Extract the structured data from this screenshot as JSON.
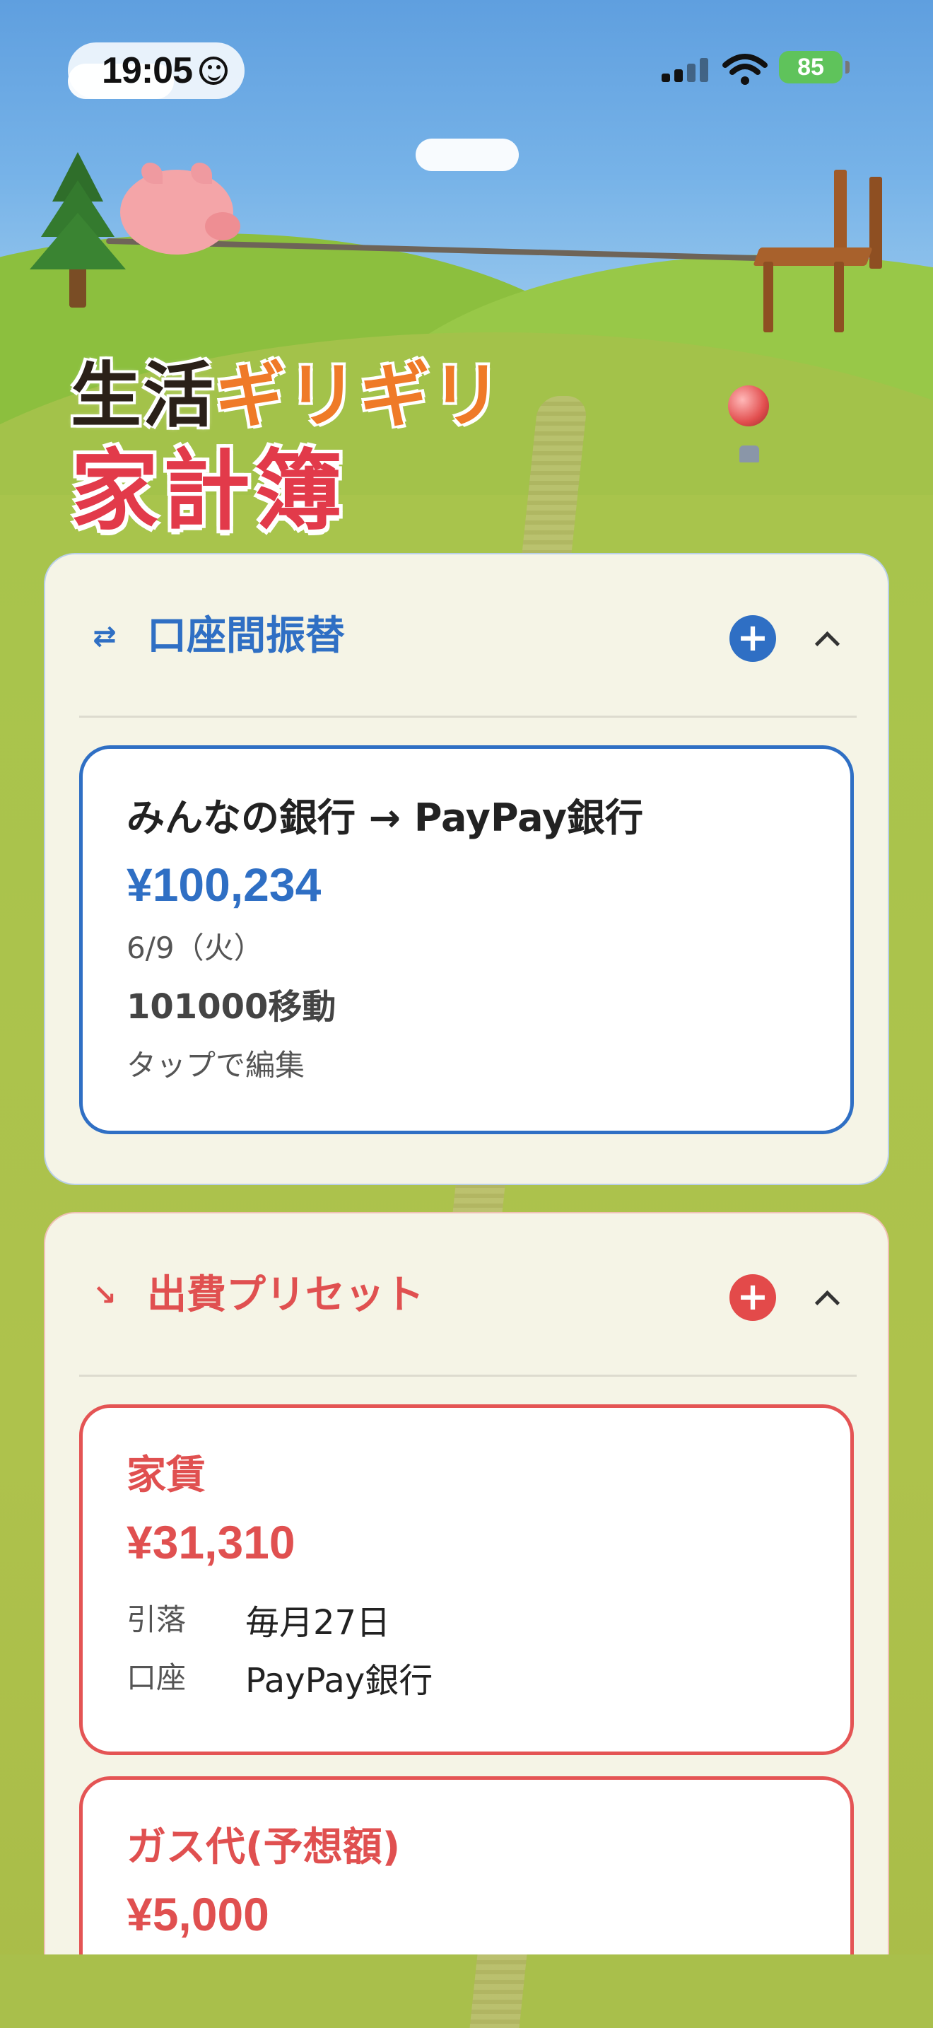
{
  "status_bar": {
    "time": "19:05",
    "battery": "85"
  },
  "logo": {
    "line1_dark": "生活",
    "line1_accent": "ギリギリ",
    "line2": "家計簿"
  },
  "transfer_section": {
    "icon": "transfer-arrows-icon",
    "title": "口座間振替",
    "color": "#2f6fc4",
    "items": [
      {
        "route": "みんなの銀行 → PayPay銀行",
        "amount": "¥100,234",
        "date": "6/9（火）",
        "memo": "101000移動",
        "hint": "タップで編集"
      }
    ]
  },
  "expense_section": {
    "icon": "trending-down-icon",
    "title": "出費プリセット",
    "color": "#e05050",
    "items": [
      {
        "name": "家賃",
        "amount": "¥31,310",
        "fields": [
          {
            "label": "引落",
            "value": "毎月27日"
          },
          {
            "label": "口座",
            "value": "PayPay銀行"
          }
        ]
      },
      {
        "name": "ガス代(予想額)",
        "amount": "¥5,000"
      }
    ]
  }
}
